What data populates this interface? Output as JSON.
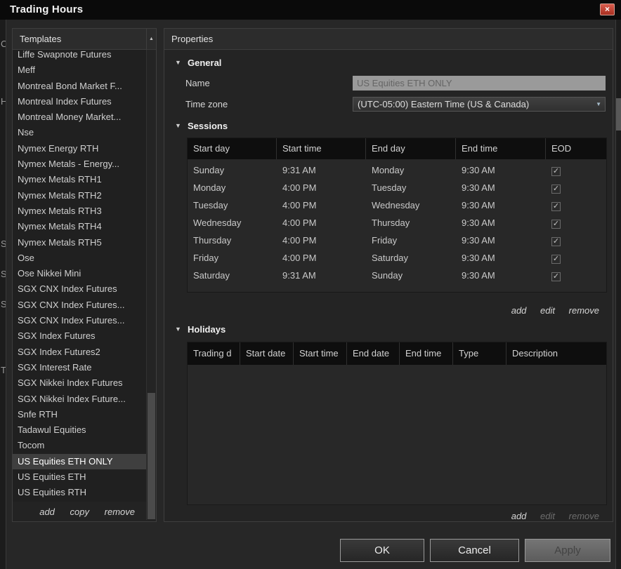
{
  "window": {
    "title": "Trading Hours"
  },
  "icons": {
    "close": "×",
    "check": "✓",
    "section_collapse": "▼",
    "scroll_up": "▲",
    "scroll_down": "▼",
    "dropdown": "▼"
  },
  "colors": {
    "accent_red": "#c0392b",
    "selection": "#3f3f3f"
  },
  "background_edge": {
    "left_fragments": [
      "C",
      "H",
      "S",
      "S",
      "S",
      "T"
    ]
  },
  "templates_panel": {
    "header": "Templates",
    "items": [
      "Liffe Swapnote Futures",
      "Meff",
      "Montreal Bond Market F...",
      "Montreal Index Futures",
      "Montreal Money Market...",
      "Nse",
      "Nymex Energy RTH",
      "Nymex Metals - Energy...",
      "Nymex Metals RTH1",
      "Nymex Metals RTH2",
      "Nymex Metals RTH3",
      "Nymex Metals RTH4",
      "Nymex Metals RTH5",
      "Ose",
      "Ose Nikkei Mini",
      "SGX CNX Index Futures",
      "SGX CNX Index Futures...",
      "SGX CNX Index Futures...",
      "SGX Index Futures",
      "SGX Index Futures2",
      "SGX Interest Rate",
      "SGX Nikkei Index Futures",
      "SGX Nikkei Index Future...",
      "Snfe RTH",
      "Tadawul Equities",
      "Tocom",
      "US Equities ETH ONLY",
      "US Equities ETH",
      "US Equities RTH"
    ],
    "selected_item": "US Equities ETH ONLY",
    "selected_index": 26,
    "links": {
      "add": "add",
      "copy": "copy",
      "remove": "remove"
    }
  },
  "properties_panel": {
    "header": "Properties",
    "general": {
      "section_label": "General",
      "name_label": "Name",
      "name_value": "US Equities ETH ONLY",
      "timezone_label": "Time zone",
      "timezone_value": "(UTC-05:00) Eastern Time (US & Canada)"
    },
    "sessions": {
      "section_label": "Sessions",
      "columns": [
        "Start day",
        "Start time",
        "End day",
        "End time",
        "EOD"
      ],
      "rows": [
        {
          "start_day": "Sunday",
          "start_time": "9:31 AM",
          "end_day": "Monday",
          "end_time": "9:30 AM",
          "eod": true
        },
        {
          "start_day": "Monday",
          "start_time": "4:00 PM",
          "end_day": "Tuesday",
          "end_time": "9:30 AM",
          "eod": true
        },
        {
          "start_day": "Tuesday",
          "start_time": "4:00 PM",
          "end_day": "Wednesday",
          "end_time": "9:30 AM",
          "eod": true
        },
        {
          "start_day": "Wednesday",
          "start_time": "4:00 PM",
          "end_day": "Thursday",
          "end_time": "9:30 AM",
          "eod": true
        },
        {
          "start_day": "Thursday",
          "start_time": "4:00 PM",
          "end_day": "Friday",
          "end_time": "9:30 AM",
          "eod": true
        },
        {
          "start_day": "Friday",
          "start_time": "4:00 PM",
          "end_day": "Saturday",
          "end_time": "9:30 AM",
          "eod": true
        },
        {
          "start_day": "Saturday",
          "start_time": "9:31 AM",
          "end_day": "Sunday",
          "end_time": "9:30 AM",
          "eod": true
        }
      ],
      "links": {
        "add": "add",
        "edit": "edit",
        "remove": "remove"
      }
    },
    "holidays": {
      "section_label": "Holidays",
      "columns": [
        "Trading d",
        "Start date",
        "Start time",
        "End date",
        "End time",
        "Type",
        "Description"
      ],
      "rows": [],
      "links": {
        "add": "add",
        "edit": "edit",
        "remove": "remove"
      }
    }
  },
  "footer": {
    "ok": "OK",
    "cancel": "Cancel",
    "apply": "Apply"
  }
}
